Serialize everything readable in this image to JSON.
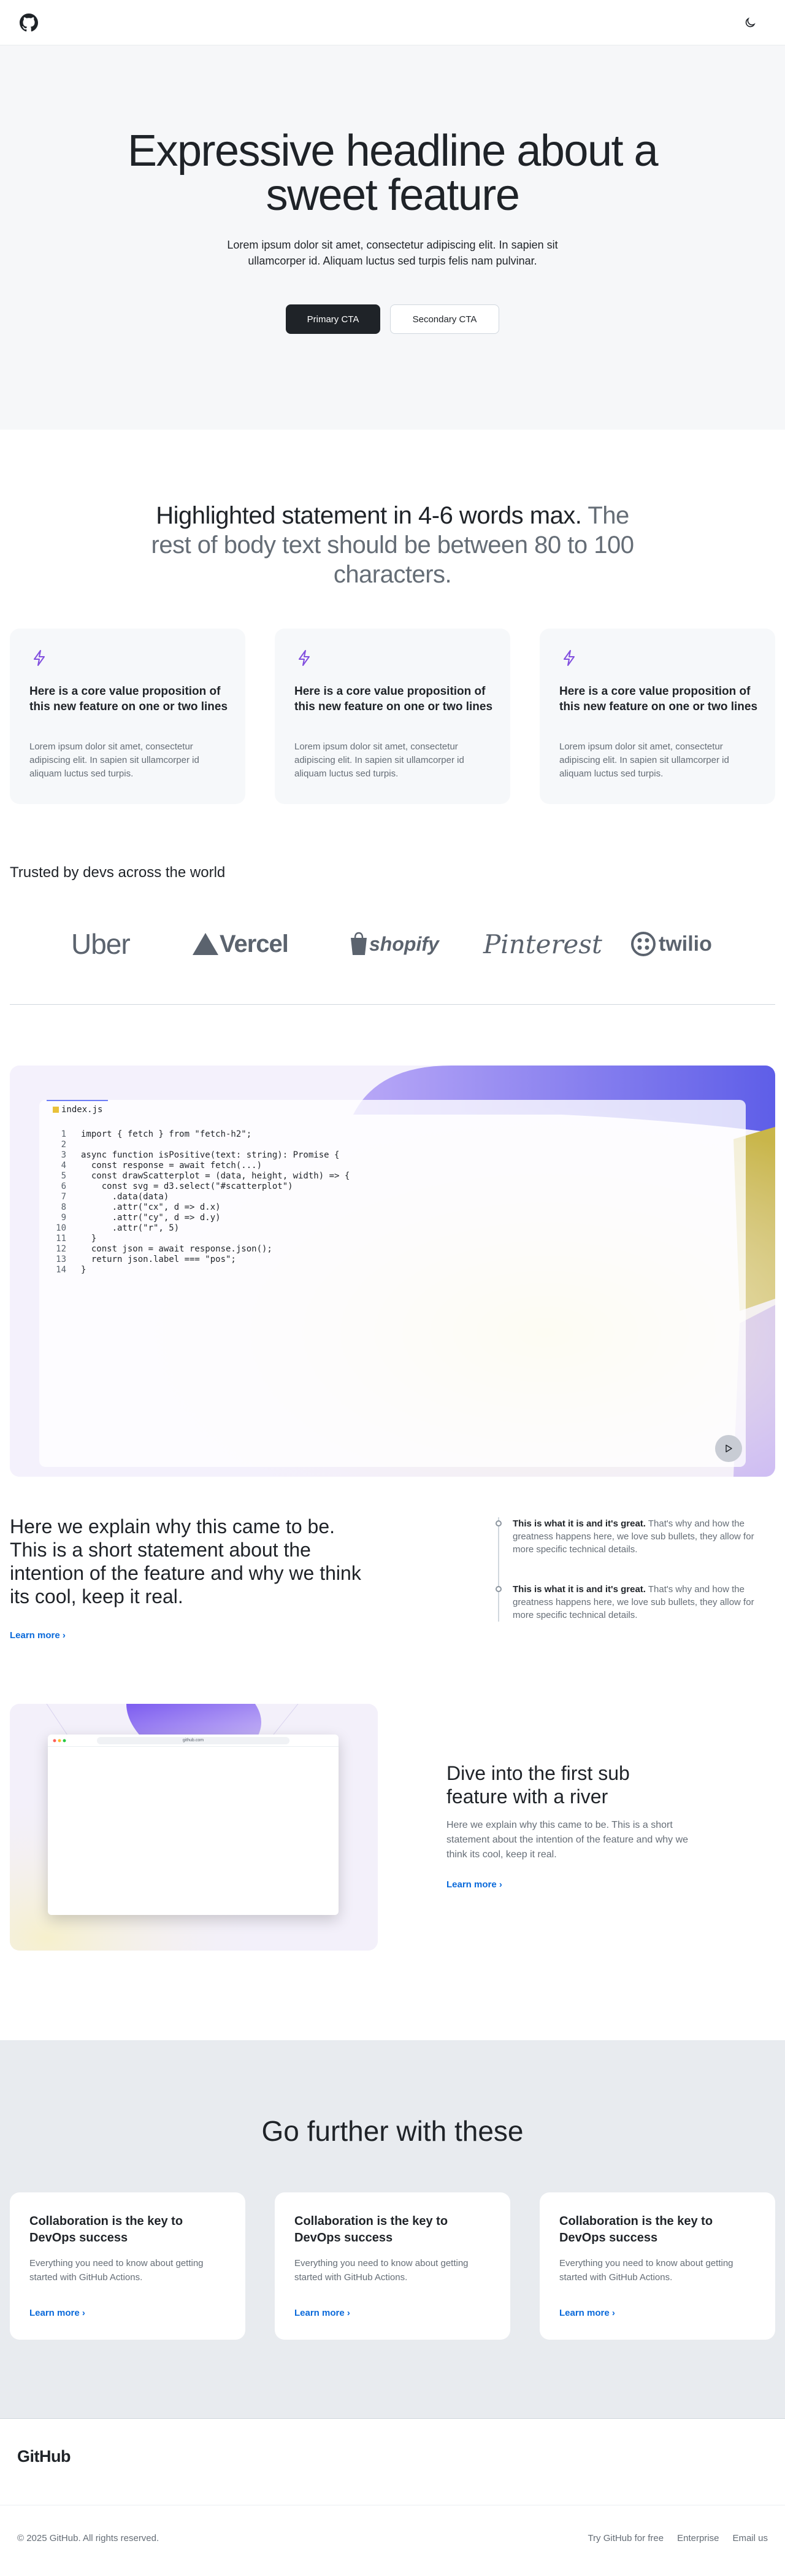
{
  "header": {
    "logo_icon": "github-mark-icon",
    "theme_icon": "moon-icon"
  },
  "hero": {
    "title": "Expressive headline about a sweet feature",
    "subtitle": "Lorem ipsum dolor sit amet, consectetur adipiscing elit. In sapien sit ullamcorper id. Aliquam luctus sed turpis felis nam pulvinar.",
    "primary_cta": "Primary CTA",
    "secondary_cta": "Secondary CTA"
  },
  "statement": {
    "highlight": "Highlighted statement in 4-6 words max.",
    "rest": "The rest of body text should be between 80 to 100 characters."
  },
  "value_cards": [
    {
      "icon": "zap-icon",
      "title": "Here is a core value proposition of this new feature on one or two lines",
      "body": "Lorem ipsum dolor sit amet, consectetur adipiscing elit. In sapien sit ullamcorper id aliquam luctus sed turpis."
    },
    {
      "icon": "zap-icon",
      "title": "Here is a core value proposition of this new feature on one or two lines",
      "body": "Lorem ipsum dolor sit amet, consectetur adipiscing elit. In sapien sit ullamcorper id aliquam luctus sed turpis."
    },
    {
      "icon": "zap-icon",
      "title": "Here is a core value proposition of this new feature on one or two lines",
      "body": "Lorem ipsum dolor sit amet, consectetur adipiscing elit. In sapien sit ullamcorper id aliquam luctus sed turpis."
    }
  ],
  "trusted": {
    "title": "Trusted by devs across the world",
    "logos": [
      "Uber",
      "Vercel",
      "shopify",
      "Pinterest",
      "twilio"
    ]
  },
  "code": {
    "filename": "index.js",
    "lines": [
      "import { fetch } from \"fetch-h2\";",
      "",
      "async function isPositive(text: string): Promise {",
      "  const response = await fetch(...)",
      "  const drawScatterplot = (data, height, width) => {",
      "    const svg = d3.select(\"#scatterplot\")",
      "      .data(data)",
      "      .attr(\"cx\", d => d.x)",
      "      .attr(\"cy\", d => d.y)",
      "      .attr(\"r\", 5)",
      "  }",
      "  const json = await response.json();",
      "  return json.label === \"pos\";",
      "}"
    ],
    "play_icon": "play-icon"
  },
  "explain": {
    "statement": "Here we explain why this came to be. This is a short statement about the intention of the feature and why we think its cool, keep it real.",
    "learn_more": "Learn more",
    "bullets": [
      {
        "lead": "This is what it is and it's great.",
        "text": " That's why and how the greatness happens here, we love sub bullets, they allow for more specific technical details."
      },
      {
        "lead": "This is what it is and it's great.",
        "text": " That's why and how the greatness happens here, we love sub bullets, they allow for more specific technical details."
      }
    ]
  },
  "river": {
    "browser_url": "github.com",
    "title": "Dive into the first sub feature with a river",
    "body": "Here we explain why this came to be. This is a short statement about the intention of the feature and why we think its cool, keep it real.",
    "learn_more": "Learn more"
  },
  "further": {
    "title": "Go further with these",
    "cards": [
      {
        "title": "Collaboration is the key to DevOps success",
        "body": "Everything you need to know about getting started with GitHub Actions.",
        "link": "Learn more"
      },
      {
        "title": "Collaboration is the key to DevOps success",
        "body": "Everything you need to know about getting started with GitHub Actions.",
        "link": "Learn more"
      },
      {
        "title": "Collaboration is the key to DevOps success",
        "body": "Everything you need to know about getting started with GitHub Actions.",
        "link": "Learn more"
      }
    ]
  },
  "footer": {
    "logo": "GitHub",
    "copyright": "© 2025 GitHub. All rights reserved.",
    "links": [
      "Try GitHub for free",
      "Enterprise",
      "Email us"
    ]
  },
  "colors": {
    "accent": "#0969da",
    "brand_dark": "#1f2328",
    "purple": "#8250df"
  }
}
